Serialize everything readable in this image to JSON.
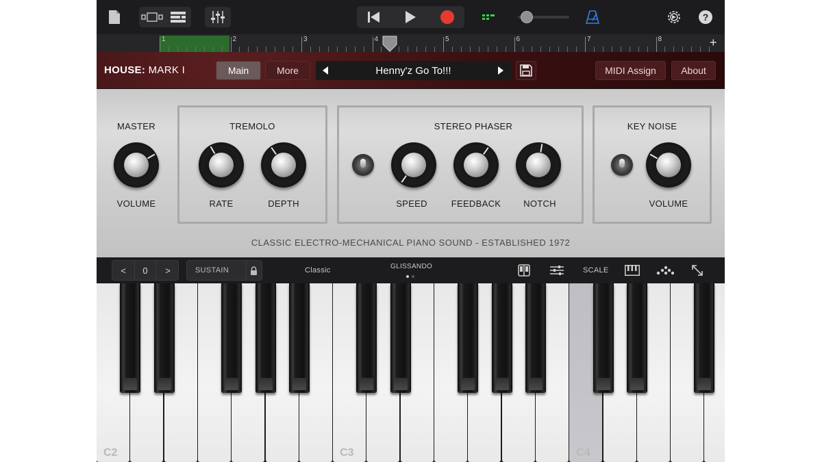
{
  "toolbar": {
    "icons": [
      "document-icon",
      "tracks-view-icon",
      "list-view-icon",
      "mixer-icon",
      "rewind-icon",
      "play-icon",
      "record-icon",
      "level-meter-icon",
      "volume-slider",
      "metronome-icon",
      "settings-icon",
      "help-icon"
    ],
    "help_label": "?",
    "record_color": "#e8392f",
    "metronome_color": "#2f80ed",
    "meter_color": "#3ccf4e"
  },
  "ruler": {
    "bars": [
      "1",
      "2",
      "3",
      "4",
      "5",
      "6",
      "7",
      "8"
    ],
    "plus_label": "+",
    "region_color": "#2c6b2c"
  },
  "header": {
    "instrument_brand": "HOUSE:",
    "instrument_model": "MARK I",
    "main_label": "Main",
    "more_label": "More",
    "patch_name": "Henny'z Go To!!!",
    "midi_assign_label": "MIDI Assign",
    "about_label": "About"
  },
  "panel": {
    "master": {
      "title": "MASTER",
      "volume_label": "VOLUME"
    },
    "tremolo": {
      "title": "TREMOLO",
      "rate_label": "RATE",
      "depth_label": "DEPTH"
    },
    "stereo_phaser": {
      "title": "STEREO PHASER",
      "speed_label": "SPEED",
      "feedback_label": "FEEDBACK",
      "notch_label": "NOTCH"
    },
    "key_noise": {
      "title": "KEY NOISE",
      "volume_label": "VOLUME"
    },
    "tagline": "CLASSIC ELECTRO-MECHANICAL PIANO SOUND - ESTABLISHED 1972"
  },
  "keyboard_bar": {
    "octave_prev": "<",
    "octave_value": "0",
    "octave_next": ">",
    "sustain_label": "SUSTAIN",
    "mode_label": "Classic",
    "glissando_label": "GLISSANDO",
    "scale_label": "SCALE"
  },
  "keyboard": {
    "octave_labels": [
      "C2",
      "C3",
      "C4"
    ],
    "pressed_key": "C4"
  }
}
